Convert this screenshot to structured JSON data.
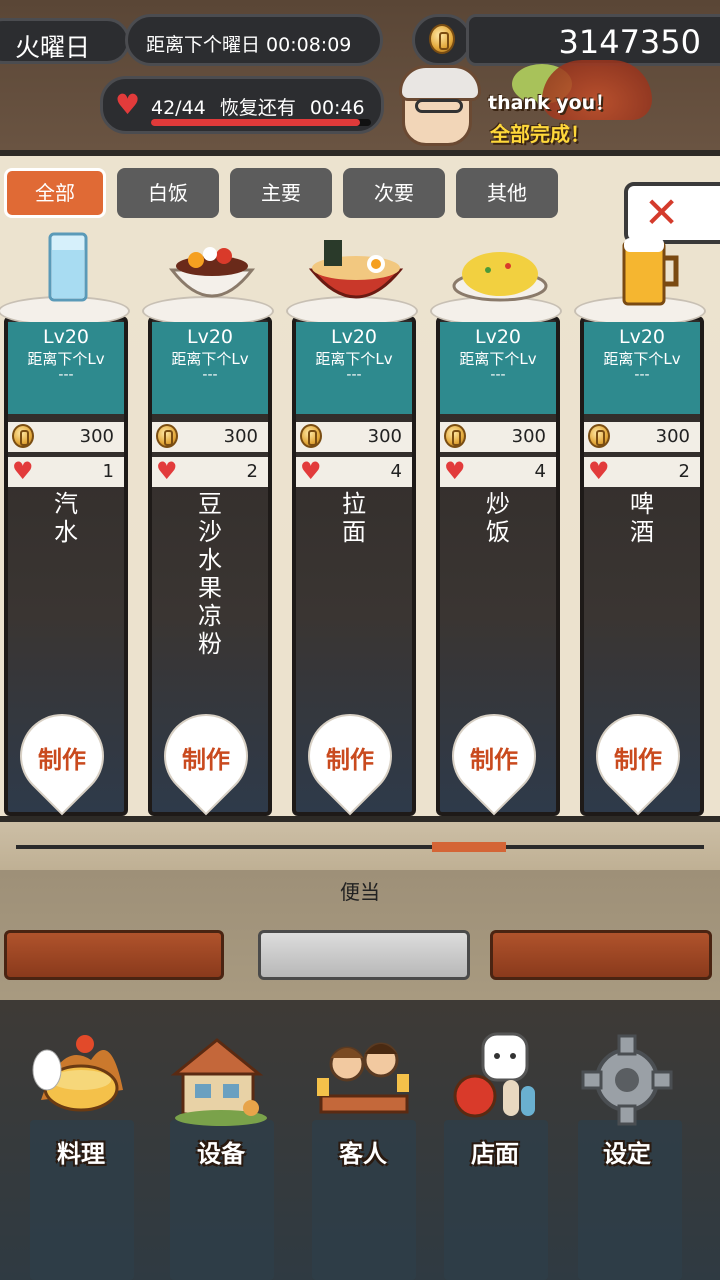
{
  "hud": {
    "day": "火曜日",
    "next_day": "距离下个曜日 00:08:09",
    "money": "3147350",
    "hearts": "42/44",
    "recover_label": "恢复还有",
    "recover_time": "00:46",
    "hearts_fraction": 0.95
  },
  "banner": {
    "thank_you": "thank you！",
    "all_done": "全部完成！"
  },
  "tabs": [
    {
      "label": "全部",
      "active": true
    },
    {
      "label": "白饭",
      "active": false
    },
    {
      "label": "主要",
      "active": false
    },
    {
      "label": "次要",
      "active": false
    },
    {
      "label": "其他",
      "active": false
    }
  ],
  "dishes": [
    {
      "level": "Lv20",
      "next": "距离下个Lv",
      "dash": "---",
      "price": "300",
      "love": "1",
      "name": "汽\n水",
      "icon": "soda-glass-icon",
      "make": "制作"
    },
    {
      "level": "Lv20",
      "next": "距离下个Lv",
      "dash": "---",
      "price": "300",
      "love": "2",
      "name": "豆\n沙\n水\n果\n凉\n粉",
      "icon": "anmitsu-bowl-icon",
      "make": "制作"
    },
    {
      "level": "Lv20",
      "next": "距离下个Lv",
      "dash": "---",
      "price": "300",
      "love": "4",
      "name": "拉\n面",
      "icon": "ramen-bowl-icon",
      "make": "制作"
    },
    {
      "level": "Lv20",
      "next": "距离下个Lv",
      "dash": "---",
      "price": "300",
      "love": "4",
      "name": "炒\n饭",
      "icon": "fried-rice-icon",
      "make": "制作"
    },
    {
      "level": "Lv20",
      "next": "距离下个Lv",
      "dash": "---",
      "price": "300",
      "love": "2",
      "name": "啤\n酒",
      "icon": "beer-mug-icon",
      "make": "制作"
    }
  ],
  "section_label": "便当",
  "nav": [
    {
      "label": "料理",
      "icon": "cooking-pot-icon"
    },
    {
      "label": "设备",
      "icon": "shop-building-icon"
    },
    {
      "label": "客人",
      "icon": "customers-icon"
    },
    {
      "label": "店面",
      "icon": "lucky-cat-icon"
    },
    {
      "label": "设定",
      "icon": "gear-icon"
    }
  ],
  "colors": {
    "accent": "#e06a35",
    "teal": "#2e8a8e",
    "heart": "#e23b3b"
  }
}
